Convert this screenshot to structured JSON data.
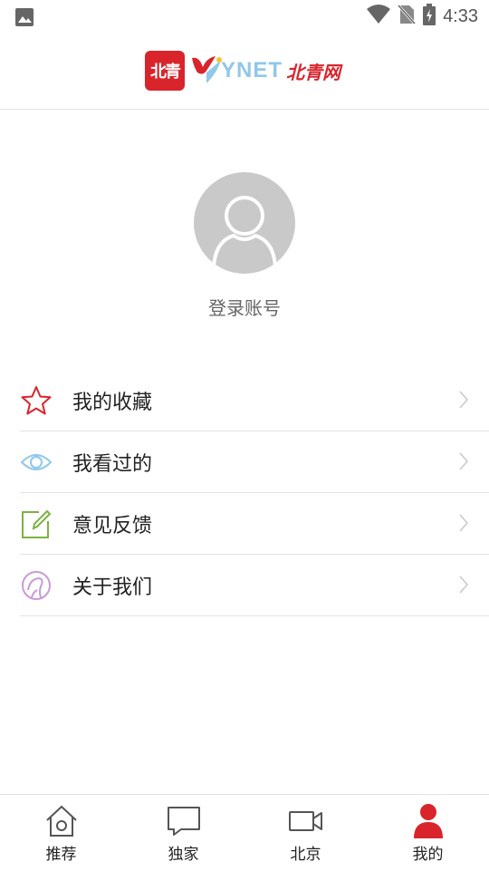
{
  "status_bar": {
    "time": "4:33",
    "icons": [
      "image-notification-icon",
      "wifi-icon",
      "no-sim-icon",
      "battery-charging-icon"
    ]
  },
  "header": {
    "logo_badge": "北青",
    "logo_brand": "YNET",
    "logo_brand_cn": "北青网"
  },
  "profile": {
    "login_label": "登录账号"
  },
  "menu": {
    "items": [
      {
        "label": "我的收藏",
        "icon": "star-icon",
        "color": "#d9242c"
      },
      {
        "label": "我看过的",
        "icon": "eye-icon",
        "color": "#8fc8ea"
      },
      {
        "label": "意见反馈",
        "icon": "edit-icon",
        "color": "#7cb342"
      },
      {
        "label": "关于我们",
        "icon": "about-icon",
        "color": "#c99ad6"
      }
    ]
  },
  "tabbar": {
    "tabs": [
      {
        "label": "推荐",
        "icon": "home-icon",
        "active": false
      },
      {
        "label": "独家",
        "icon": "chat-bubble-icon",
        "active": false
      },
      {
        "label": "北京",
        "icon": "video-camera-icon",
        "active": false
      },
      {
        "label": "我的",
        "icon": "person-icon",
        "active": true
      }
    ]
  },
  "colors": {
    "brand_red": "#d9242c",
    "avatar_gray": "#c9c9c9",
    "divider": "#e3e3e3"
  }
}
